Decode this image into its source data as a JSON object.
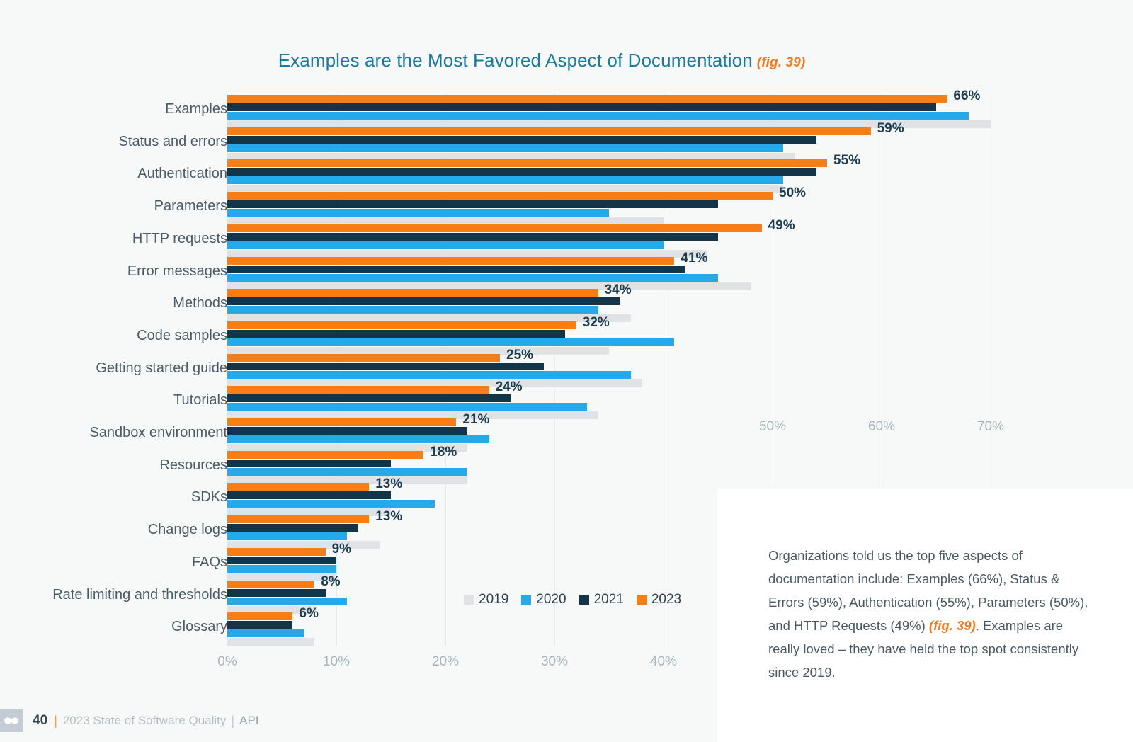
{
  "title": {
    "text": "Examples are the Most Favored Aspect of Documentation",
    "figure_ref": "(fig. 39)"
  },
  "colors": {
    "title": "#1c7a9c",
    "accent_orange": "#f47b20",
    "y2019": "#dfe3e6",
    "y2020": "#26a9e8",
    "y2021": "#13354a",
    "y2023": "#f97d15",
    "background": "#f7f9f9",
    "panel": "#ffffff",
    "label": "#4a5c68",
    "tick": "#a7b5bd"
  },
  "legend": {
    "position": "bottom-center",
    "items": [
      {
        "label": "2019",
        "color": "#dfe3e6"
      },
      {
        "label": "2020",
        "color": "#26a9e8"
      },
      {
        "label": "2021",
        "color": "#13354a"
      },
      {
        "label": "2023",
        "color": "#f97d15"
      }
    ]
  },
  "axis": {
    "main_ticks": [
      "0%",
      "10%",
      "20%",
      "30%",
      "40%"
    ],
    "far_ticks": [
      "50%",
      "60%",
      "70%"
    ]
  },
  "side_panel": {
    "paragraph_part1": "Organizations told us the top five aspects of documentation include: Examples (66%), Status & Errors (59%), Authentication (55%), Parameters (50%), and HTTP Requests (49%) ",
    "figure_ref": "(fig. 39)",
    "paragraph_part2": ". Examples are really loved – they have held the top spot consistently since 2019."
  },
  "footer": {
    "page_number": "40",
    "separator": "|",
    "document": "2023 State of Software Quality",
    "separator2": "|",
    "section": "API",
    "logo": "stoplight-logo-icon"
  },
  "chart_data": {
    "type": "bar",
    "orientation": "horizontal",
    "title": "Examples are the Most Favored Aspect of Documentation (fig. 39)",
    "xlabel": "",
    "ylabel": "",
    "xlim": [
      0,
      70
    ],
    "grid": true,
    "legend_position": "bottom-center",
    "value_labels_series": "2023",
    "categories": [
      "Examples",
      "Status and errors",
      "Authentication",
      "Parameters",
      "HTTP requests",
      "Error messages",
      "Methods",
      "Code samples",
      "Getting started guide",
      "Tutorials",
      "Sandbox environment",
      "Resources",
      "SDKs",
      "Change logs",
      "FAQs",
      "Rate limiting and thresholds",
      "Glossary"
    ],
    "series": [
      {
        "name": "2023",
        "color": "#f97d15",
        "values": [
          66,
          59,
          55,
          50,
          49,
          41,
          34,
          32,
          25,
          24,
          21,
          18,
          13,
          13,
          9,
          8,
          6
        ],
        "labels": [
          "66%",
          "59%",
          "55%",
          "50%",
          "49%",
          "41%",
          "34%",
          "32%",
          "25%",
          "24%",
          "21%",
          "18%",
          "13%",
          "13%",
          "9%",
          "8%",
          "6%"
        ]
      },
      {
        "name": "2021",
        "color": "#13354a",
        "values": [
          65,
          54,
          54,
          45,
          45,
          42,
          36,
          31,
          29,
          26,
          22,
          15,
          15,
          12,
          10,
          9,
          6
        ]
      },
      {
        "name": "2020",
        "color": "#26a9e8",
        "values": [
          68,
          51,
          51,
          35,
          40,
          45,
          34,
          41,
          37,
          33,
          24,
          22,
          19,
          11,
          10,
          11,
          7
        ]
      },
      {
        "name": "2019",
        "color": "#dfe3e6",
        "values": [
          70,
          52,
          51,
          40,
          44,
          48,
          37,
          35,
          38,
          34,
          22,
          22,
          15,
          14,
          10,
          8,
          8
        ]
      }
    ]
  }
}
